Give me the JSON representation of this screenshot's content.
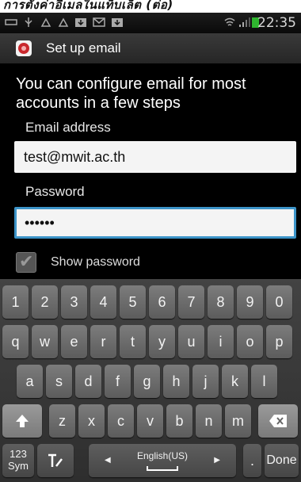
{
  "caption": {
    "text": "การตั้งค่าอีเมลในแท็บเล็ต (ต่อ)"
  },
  "status_bar": {
    "time": "22:35",
    "icons": [
      "usb-icon",
      "android-icon",
      "android-icon",
      "download-icon",
      "mail-icon",
      "download-icon",
      "wifi-icon",
      "signal-icon",
      "battery-icon"
    ]
  },
  "titlebar": {
    "title": "Set up email"
  },
  "form": {
    "intro": "You can configure email for most accounts in a few steps",
    "email_label": "Email address",
    "email_value": "test@mwit.ac.th",
    "password_label": "Password",
    "password_value": "••••••",
    "show_password_label": "Show password",
    "show_password_checked": true
  },
  "keyboard": {
    "row1": [
      "1",
      "2",
      "3",
      "4",
      "5",
      "6",
      "7",
      "8",
      "9",
      "0"
    ],
    "row2": [
      "q",
      "w",
      "e",
      "r",
      "t",
      "y",
      "u",
      "i",
      "o",
      "p"
    ],
    "row3": [
      "a",
      "s",
      "d",
      "f",
      "g",
      "h",
      "j",
      "k",
      "l"
    ],
    "row4": [
      "z",
      "x",
      "c",
      "v",
      "b",
      "n",
      "m"
    ],
    "sym_label": "123\nSym",
    "language_label": "English(US)",
    "done_label": "Done",
    "dot_label": "."
  }
}
